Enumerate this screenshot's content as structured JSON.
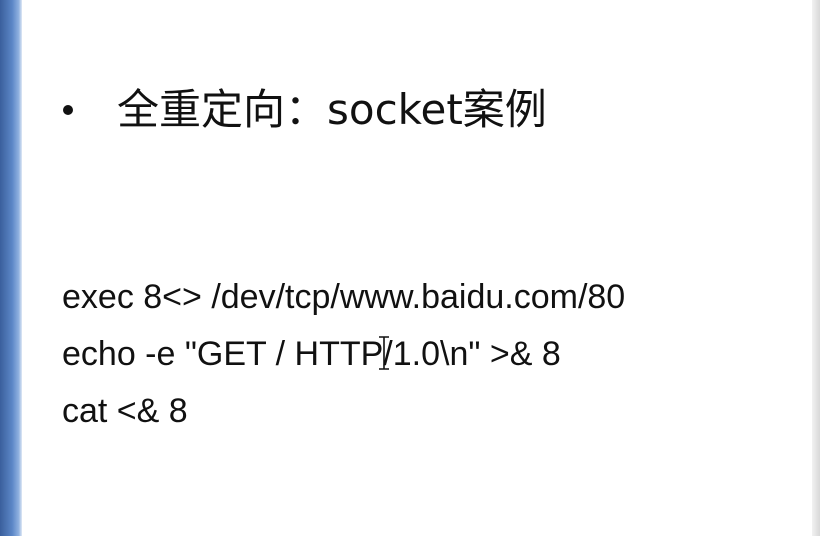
{
  "slide": {
    "bullet_title": "全重定向：socket案例",
    "code_lines": [
      "exec 8<> /dev/tcp/www.baidu.com/80",
      "echo -e \"GET / HTTP/1.0\\n\" >& 8",
      "cat <& 8"
    ]
  },
  "colors": {
    "background": "#ffffff",
    "text": "#111111",
    "left_border": "#5b86c6"
  },
  "icons": {
    "bullet": "bullet-dot-icon",
    "cursor": "text-cursor-icon"
  }
}
